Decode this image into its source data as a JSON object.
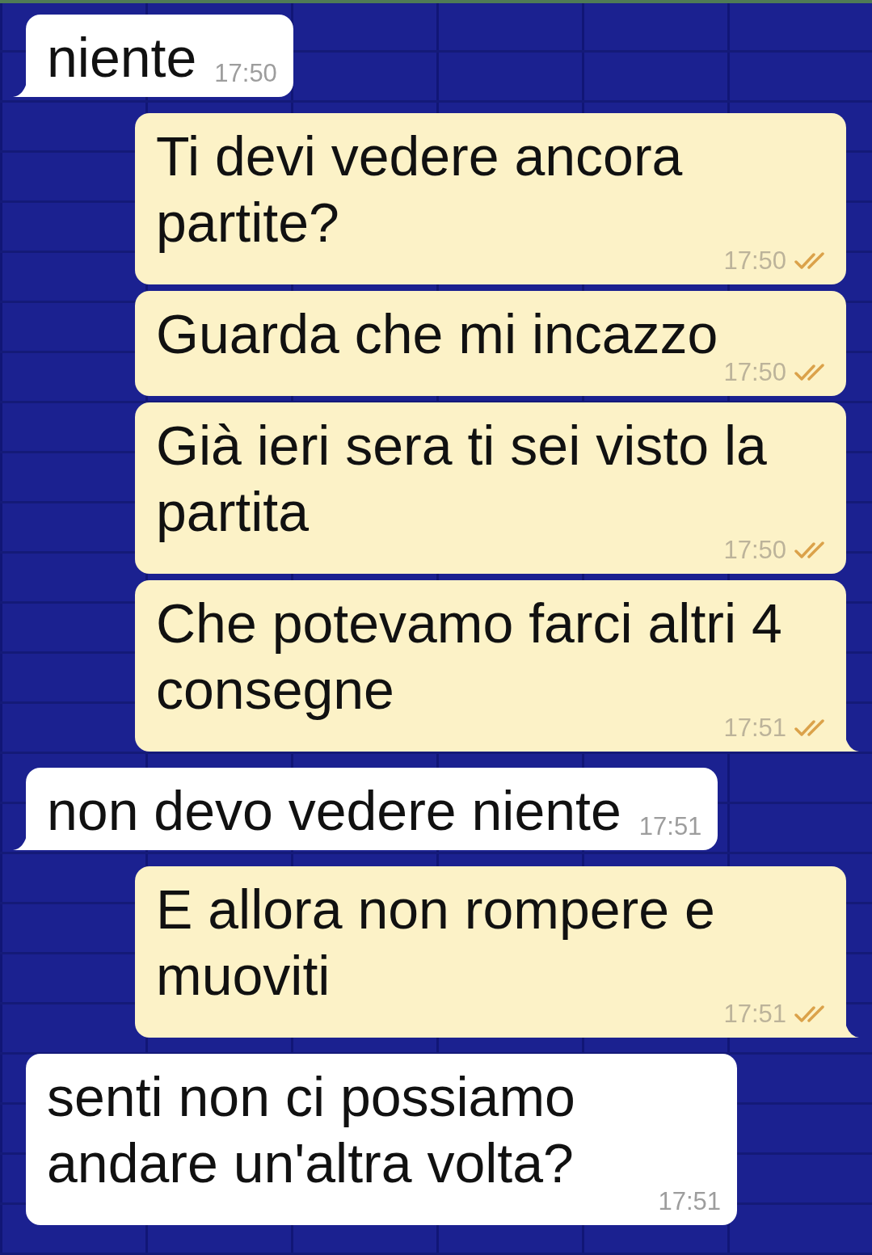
{
  "messages": [
    {
      "text": "niente",
      "time": "17:50",
      "outgoing": false,
      "tail": true
    },
    {
      "text": "Ti devi vedere ancora partite?",
      "time": "17:50",
      "outgoing": true,
      "tail": false,
      "read": true
    },
    {
      "text": "Guarda che mi incazzo",
      "time": "17:50",
      "outgoing": true,
      "tail": false,
      "read": true
    },
    {
      "text": "Già ieri sera ti sei visto la partita",
      "time": "17:50",
      "outgoing": true,
      "tail": false,
      "read": true
    },
    {
      "text": "Che potevamo farci altri 4 consegne",
      "time": "17:51",
      "outgoing": true,
      "tail": true,
      "read": true
    },
    {
      "text": "non devo vedere niente",
      "time": "17:51",
      "outgoing": false,
      "tail": true
    },
    {
      "text": "E allora non rompere e muoviti",
      "time": "17:51",
      "outgoing": true,
      "tail": true,
      "read": true
    },
    {
      "text": "senti non ci possiamo andare un'altra volta?",
      "time": "17:51",
      "outgoing": false,
      "tail": false
    }
  ]
}
